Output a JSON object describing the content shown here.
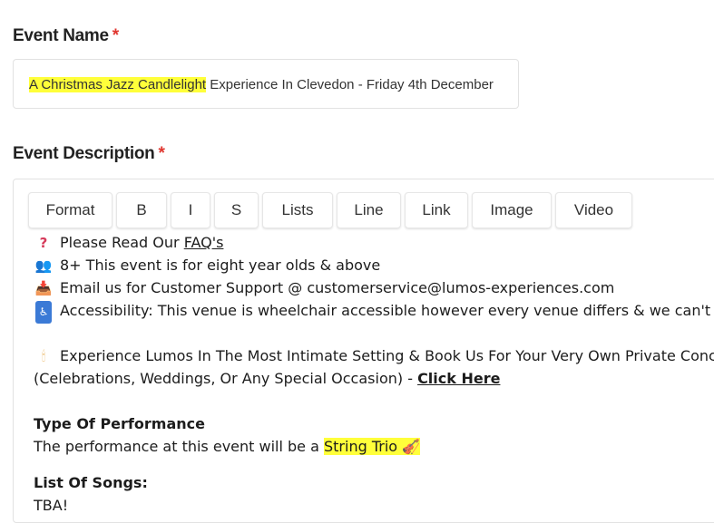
{
  "event_name": {
    "label": "Event Name",
    "required_mark": "*",
    "value_highlighted": "A Christmas Jazz Candlelight",
    "value_rest": " Experience In Clevedon - Friday 4th December"
  },
  "event_description": {
    "label": "Event Description",
    "required_mark": "*",
    "toolbar": [
      "Format",
      "B",
      "I",
      "S",
      "Lists",
      "Line",
      "Link",
      "Image",
      "Video"
    ],
    "content": {
      "faq_prefix": "Please Read Our ",
      "faq_link": "FAQ's",
      "age_text": "8+ This event is for eight year olds & above",
      "email_text": "Email us for Customer Support @ customerservice@lumos-experiences.com",
      "accessibility_text": "Accessibility: This venue is wheelchair accessible however every venue differs & we can't guarantee",
      "private_text": "Experience Lumos In The Most Intimate Setting & Book Us For Your Very Own Private Concert",
      "private_text_2": "(Celebrations, Weddings, Or Any Special Occasion) - ",
      "click_here": " Click Here",
      "perf_heading": "Type Of Performance",
      "perf_prefix": "The performance at this event will be a ",
      "perf_highlight": "String Trio 🎻",
      "songs_heading": "List Of Songs:",
      "songs_value": "TBA!"
    }
  },
  "colors": {
    "highlight": "#ffff3a",
    "required": "#e0362f",
    "border": "#e2e2e2"
  },
  "icons": {
    "faq": "question-icon",
    "age": "people-icon",
    "email": "inbox-icon",
    "accessibility": "wheelchair-icon",
    "private": "candle-icon"
  }
}
